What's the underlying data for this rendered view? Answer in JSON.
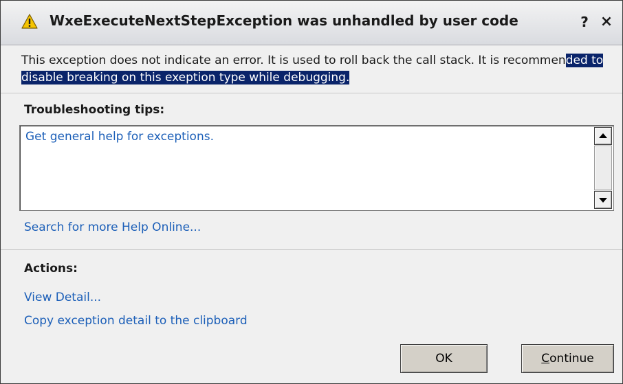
{
  "title": "WxeExecuteNextStepException was unhandled by user code",
  "titlebar": {
    "help_label": "?",
    "close_label": "×"
  },
  "message": {
    "part1": "This exception does not indicate an error. It is used to roll back the call stack. It is recommen",
    "highlighted": "ded to disable breaking on this exeption type while debugging."
  },
  "troubleshooting": {
    "title": "Troubleshooting tips:",
    "items": [
      "Get general help for exceptions."
    ]
  },
  "search_link": "Search for more Help Online...",
  "actions": {
    "title": "Actions:",
    "items": [
      "View Detail...",
      "Copy exception detail to the clipboard"
    ]
  },
  "buttons": {
    "ok": "OK",
    "continue_mnemonic": "C",
    "continue_rest": "ontinue"
  },
  "icons": {
    "warning": "warning-icon",
    "scroll_up": "scroll-up-icon",
    "scroll_down": "scroll-down-icon"
  },
  "colors": {
    "link": "#1c5fb8",
    "selection": "#0a246a",
    "warning": "#f5c400"
  }
}
